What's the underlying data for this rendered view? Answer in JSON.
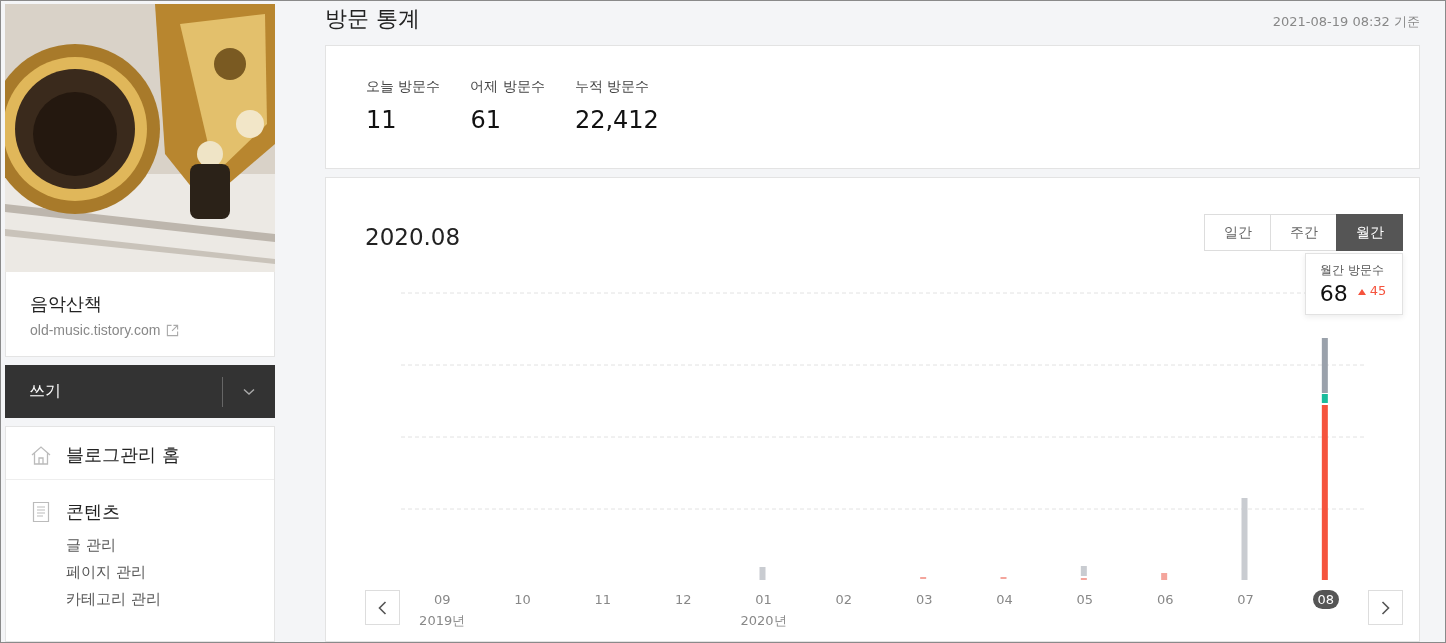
{
  "profile": {
    "blog_name": "음악산책",
    "url": "old-music.tistory.com"
  },
  "write_button": {
    "label": "쓰기"
  },
  "menu": [
    {
      "kind": "home",
      "label": "블로그관리 홈"
    },
    {
      "kind": "contents",
      "label": "콘텐츠",
      "items": [
        "글 관리",
        "페이지 관리",
        "카테고리 관리"
      ]
    }
  ],
  "page_title": "방문 통계",
  "timestamp": "2021-08-19 08:32 기준",
  "stats": [
    {
      "label": "오늘 방문수",
      "value": "11"
    },
    {
      "label": "어제 방문수",
      "value": "61"
    },
    {
      "label": "누적 방문수",
      "value": "22,412"
    }
  ],
  "period": "2020.08",
  "range_tabs": [
    {
      "label": "일간",
      "selected": false
    },
    {
      "label": "주간",
      "selected": false
    },
    {
      "label": "월간",
      "selected": true
    }
  ],
  "tooltip": {
    "label": "월간 방문수",
    "value": "68",
    "change": "45"
  },
  "months": [
    {
      "label": "09",
      "year": "2019년",
      "selected": false
    },
    {
      "label": "10",
      "selected": false
    },
    {
      "label": "11",
      "selected": false
    },
    {
      "label": "12",
      "selected": false
    },
    {
      "label": "01",
      "year": "2020년",
      "selected": false
    },
    {
      "label": "02",
      "selected": false
    },
    {
      "label": "03",
      "selected": false
    },
    {
      "label": "04",
      "selected": false
    },
    {
      "label": "05",
      "selected": false
    },
    {
      "label": "06",
      "selected": false
    },
    {
      "label": "07",
      "selected": false
    },
    {
      "label": "08",
      "selected": true
    }
  ]
}
